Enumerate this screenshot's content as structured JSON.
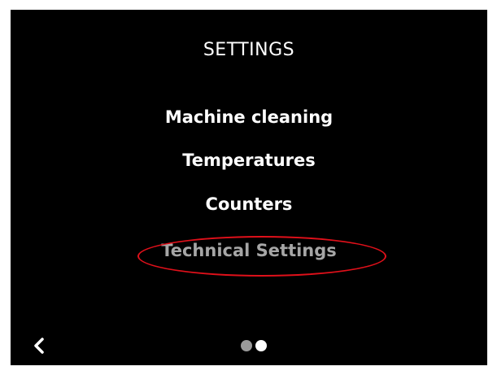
{
  "header": {
    "title": "SETTINGS"
  },
  "menu": {
    "items": [
      {
        "label": "Machine cleaning",
        "state": "normal"
      },
      {
        "label": "Temperatures",
        "state": "normal"
      },
      {
        "label": "Counters",
        "state": "normal"
      },
      {
        "label": "Technical Settings",
        "state": "dimmed"
      }
    ]
  },
  "annotation": {
    "highlight_color": "#e0101a"
  },
  "footer": {
    "back_icon": "chevron-left-icon",
    "pager": {
      "total_pages": 2,
      "current_page": 2
    }
  },
  "colors": {
    "background": "#000000",
    "text": "#ffffff",
    "dimmed_text": "#a6a6a6"
  }
}
